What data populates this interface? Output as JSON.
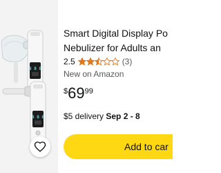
{
  "product": {
    "image_alt_icon": "nebulizer-product-image",
    "title_line1": "Smart Digital Display Po",
    "title_line2": "Nebulizer for Adults an",
    "rating": "2.5",
    "review_count": "(3)",
    "stars_value": 2.5,
    "stars_max": 5,
    "new_on": "New on Amazon",
    "price_symbol": "$",
    "price_whole": "69",
    "price_fraction": "99",
    "delivery_prefix": "$5 delivery",
    "delivery_dates": "Sep 2 - 8",
    "device_display": "8 8 8",
    "add_to_cart_label": "Add to car"
  },
  "icons": {
    "wishlist": "heart-icon",
    "star": "star-icon"
  },
  "colors": {
    "cart_button": "#ffd814",
    "star": "#de7921",
    "image_bg": "#f3f3f3",
    "text": "#0f1111",
    "secondary_text": "#565959"
  }
}
